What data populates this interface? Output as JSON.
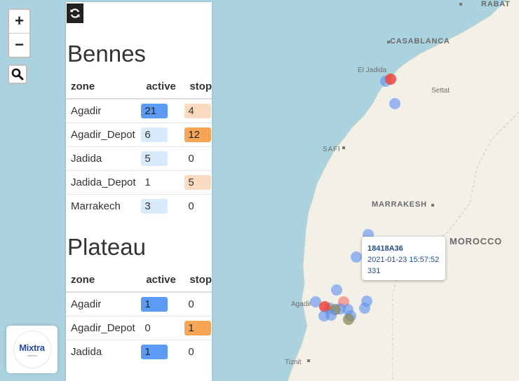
{
  "map": {
    "places": [
      "RABAT",
      "CASABLANCA",
      "El Jadida",
      "Settat",
      "SAFI",
      "MARRAKESH",
      "MOROCCO",
      "Agadir",
      "Tiznit"
    ],
    "colors": {
      "water": "#abd3df",
      "land": "#f3f0e8",
      "active": "#5b8ff0",
      "stop": "#f0443a",
      "mixed": "#8a8a5a"
    }
  },
  "controls": {
    "zoom_in": "+",
    "zoom_out": "−"
  },
  "logo": {
    "word": "Mixtra",
    "sub": "Logistics"
  },
  "panel": {
    "bennes": {
      "title": "Bennes",
      "headers": [
        "zone",
        "active",
        "stop"
      ],
      "rows": [
        {
          "zone": "Agadir",
          "active": "21",
          "stop": "4"
        },
        {
          "zone": "Agadir_Depot",
          "active": "6",
          "stop": "12"
        },
        {
          "zone": "Jadida",
          "active": "5",
          "stop": "0"
        },
        {
          "zone": "Jadida_Depot",
          "active": "1",
          "stop": "5"
        },
        {
          "zone": "Marrakech",
          "active": "3",
          "stop": "0"
        }
      ]
    },
    "plateau": {
      "title": "Plateau",
      "headers": [
        "zone",
        "active",
        "stop"
      ],
      "rows": [
        {
          "zone": "Agadir",
          "active": "1",
          "stop": "0"
        },
        {
          "zone": "Agadir_Depot",
          "active": "0",
          "stop": "1"
        },
        {
          "zone": "Jadida",
          "active": "1",
          "stop": "0"
        }
      ]
    }
  },
  "popup": {
    "id": "18418A36",
    "timestamp": "2021-01-23 15:57:52",
    "value": "331"
  }
}
